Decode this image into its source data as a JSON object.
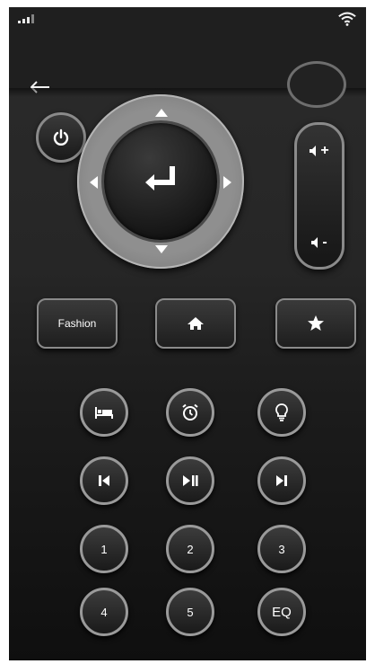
{
  "header": {
    "back_icon": "arrow-left-icon"
  },
  "status_bar": {
    "signal_icon": "signal-bars-icon",
    "wifi_icon": "wifi-icon"
  },
  "controls": {
    "power_icon": "power-icon",
    "dpad": {
      "ok_icon": "enter-icon",
      "arrows": [
        "up",
        "down",
        "left",
        "right"
      ]
    },
    "volume": {
      "up_label": "+",
      "down_label": "-",
      "icon": "speaker-icon"
    },
    "fashion_label": "Fashion",
    "home_icon": "home-icon",
    "favorite_icon": "star-icon"
  },
  "keypad": {
    "row1_icons": [
      "bed-icon",
      "alarm-clock-icon",
      "lightbulb-icon"
    ],
    "row2_icons": [
      "skip-previous-icon",
      "play-pause-icon",
      "skip-next-icon"
    ],
    "row3": [
      "1",
      "2",
      "3"
    ],
    "row4": [
      "4",
      "5",
      "EQ"
    ]
  },
  "colors": {
    "background": "#262626",
    "ring": "#9a9a9a",
    "foreground": "#ffffff"
  }
}
